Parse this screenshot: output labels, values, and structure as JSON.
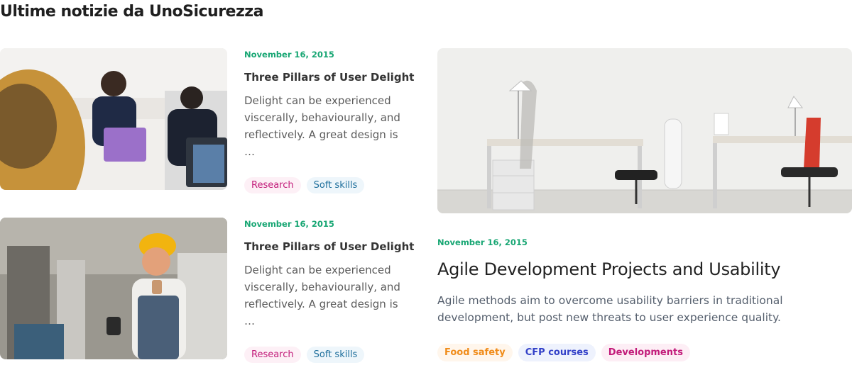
{
  "section_title": "Ultime notizie da UnoSicurezza",
  "cards": [
    {
      "date": "November 16, 2015",
      "title": "Three Pillars of User Delight",
      "excerpt": "Delight can be experienced viscerally, behaviourally, and reflectively. A great design is …",
      "tags": [
        "Research",
        "Soft skills"
      ]
    },
    {
      "date": "November 16, 2015",
      "title": "Three Pillars of User Delight",
      "excerpt": "Delight can be experienced viscerally, behaviourally, and reflectively. A great design is …",
      "tags": [
        "Research",
        "Soft skills"
      ]
    }
  ],
  "feature": {
    "date": "November 16, 2015",
    "title": "Agile Development Projects and Usability",
    "excerpt": "Agile methods aim to overcome usability barriers in traditional development, but post new threats to user experience quality.",
    "tags": [
      "Food safety",
      "CFP courses",
      "Developments"
    ]
  },
  "colors": {
    "date_green": "#17a673",
    "tag_research_bg": "#fdf0f6",
    "tag_research_fg": "#c21c7a",
    "tag_soft_bg": "#eef6fb",
    "tag_soft_fg": "#1e6f9c",
    "tag_food_bg": "#fff6ec",
    "tag_food_fg": "#f08c1a",
    "tag_cfp_bg": "#eef2fd",
    "tag_cfp_fg": "#3341c8",
    "tag_dev_bg": "#fdeef5",
    "tag_dev_fg": "#c21c7a"
  }
}
